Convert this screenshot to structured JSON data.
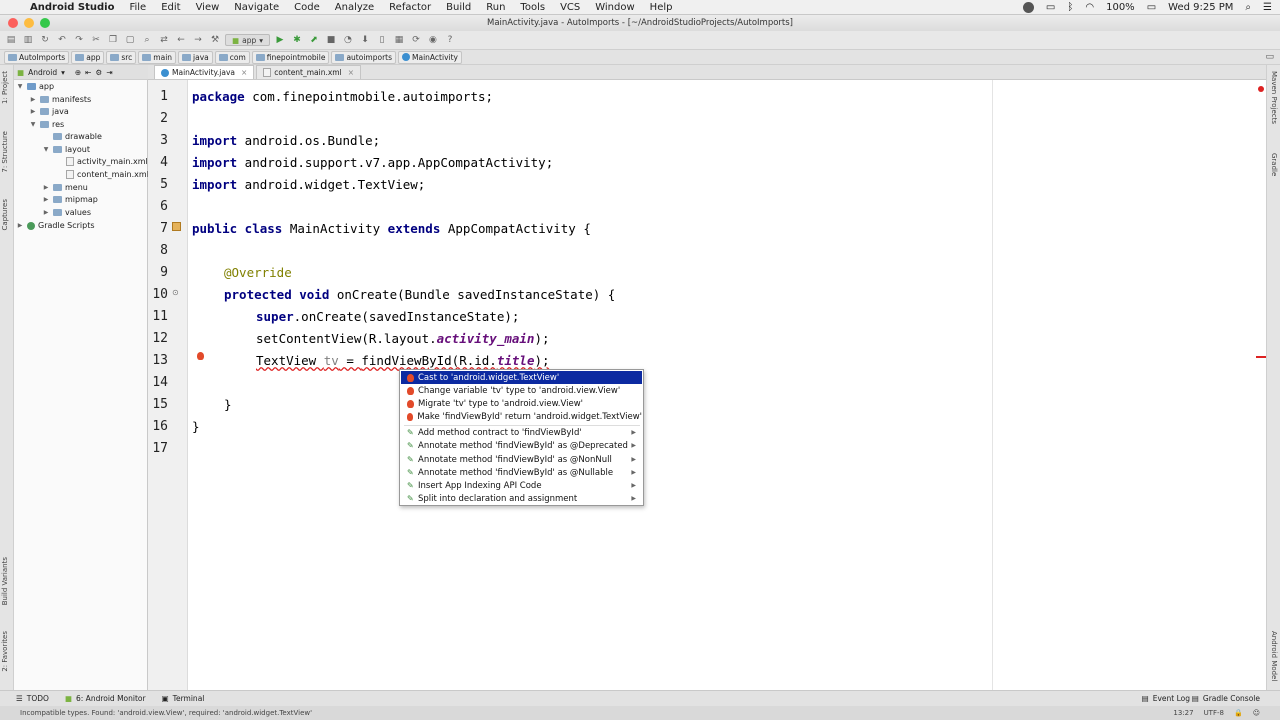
{
  "menubar": {
    "app_name": "Android Studio",
    "items": [
      "File",
      "Edit",
      "View",
      "Navigate",
      "Code",
      "Analyze",
      "Refactor",
      "Build",
      "Run",
      "Tools",
      "VCS",
      "Window",
      "Help"
    ],
    "battery": "100%",
    "clock": "Wed 9:25 PM"
  },
  "window": {
    "title": "MainActivity.java - AutoImports - [~/AndroidStudioProjects/AutoImports]"
  },
  "toolbar": {
    "run_config": "app"
  },
  "breadcrumbs": [
    "AutoImports",
    "app",
    "src",
    "main",
    "java",
    "com",
    "finepointmobile",
    "autoimports",
    "MainActivity"
  ],
  "project": {
    "view_mode": "Android",
    "tree": [
      {
        "label": "app",
        "depth": 0,
        "expanded": true,
        "kind": "module"
      },
      {
        "label": "manifests",
        "depth": 1,
        "expanded": false,
        "kind": "folder"
      },
      {
        "label": "java",
        "depth": 1,
        "expanded": false,
        "kind": "folder"
      },
      {
        "label": "res",
        "depth": 1,
        "expanded": true,
        "kind": "folder"
      },
      {
        "label": "drawable",
        "depth": 2,
        "expanded": false,
        "kind": "folder"
      },
      {
        "label": "layout",
        "depth": 2,
        "expanded": true,
        "kind": "folder"
      },
      {
        "label": "activity_main.xml",
        "depth": 3,
        "kind": "file"
      },
      {
        "label": "content_main.xml",
        "depth": 3,
        "kind": "file"
      },
      {
        "label": "menu",
        "depth": 2,
        "expanded": false,
        "kind": "folder"
      },
      {
        "label": "mipmap",
        "depth": 2,
        "expanded": false,
        "kind": "folder"
      },
      {
        "label": "values",
        "depth": 2,
        "expanded": false,
        "kind": "folder"
      },
      {
        "label": "Gradle Scripts",
        "depth": 0,
        "expanded": false,
        "kind": "gradle"
      }
    ]
  },
  "tool_windows": {
    "left": [
      "1: Project",
      "7: Structure",
      "Captures",
      "Build Variants",
      "2: Favorites"
    ],
    "right": [
      "Maven Projects",
      "Gradle",
      "Android Model"
    ]
  },
  "editor": {
    "tabs": [
      {
        "label": "MainActivity.java",
        "active": true
      },
      {
        "label": "content_main.xml",
        "active": false
      }
    ],
    "line_numbers": [
      "1",
      "2",
      "3",
      "4",
      "5",
      "6",
      "7",
      "8",
      "9",
      "10",
      "11",
      "12",
      "13",
      "14",
      "15",
      "16",
      "17"
    ],
    "code": {
      "l1_kw": "package",
      "l1_rest": " com.finepointmobile.autoimports;",
      "l3_kw": "import",
      "l3_rest": " android.os.Bundle;",
      "l4_kw": "import",
      "l4_rest": " android.support.v7.app.AppCompatActivity;",
      "l5_kw": "import",
      "l5_rest": " android.widget.TextView;",
      "l7_kw1": "public class",
      "l7_mid": " MainActivity ",
      "l7_kw2": "extends",
      "l7_rest": " AppCompatActivity {",
      "l9": "@Override",
      "l10_kw": "protected void",
      "l10_rest": " onCreate(Bundle savedInstanceState) {",
      "l11_kw": "super",
      "l11_rest": ".onCreate(savedInstanceState);",
      "l12_a": "setContentView(R.layout.",
      "l12_fld": "activity_main",
      "l12_b": ");",
      "l13_a": "TextView ",
      "l13_var": "tv",
      "l13_b": " = ",
      "l13_call": "findViewById(R.id.",
      "l13_fld": "title",
      "l13_c": ");",
      "l15": "}",
      "l16": "}"
    }
  },
  "popup": {
    "items": [
      {
        "label": "Cast to 'android.widget.TextView'",
        "icon": "bulb",
        "selected": true,
        "submenu": false
      },
      {
        "label": "Change variable 'tv' type to 'android.view.View'",
        "icon": "bulb",
        "selected": false,
        "submenu": false
      },
      {
        "label": "Migrate 'tv' type to 'android.view.View'",
        "icon": "bulb",
        "selected": false,
        "submenu": false
      },
      {
        "label": "Make 'findViewById' return 'android.widget.TextView'",
        "icon": "bulb",
        "selected": false,
        "submenu": false
      },
      {
        "label": "Add method contract to 'findViewById'",
        "icon": "pencil",
        "selected": false,
        "submenu": true
      },
      {
        "label": "Annotate method 'findViewById' as @Deprecated",
        "icon": "pencil",
        "selected": false,
        "submenu": true
      },
      {
        "label": "Annotate method 'findViewById' as @NonNull",
        "icon": "pencil",
        "selected": false,
        "submenu": true
      },
      {
        "label": "Annotate method 'findViewById' as @Nullable",
        "icon": "pencil",
        "selected": false,
        "submenu": true
      },
      {
        "label": "Insert App Indexing API Code",
        "icon": "pencil",
        "selected": false,
        "submenu": true
      },
      {
        "label": "Split into declaration and assignment",
        "icon": "pencil",
        "selected": false,
        "submenu": true
      }
    ]
  },
  "bottom_tabs": {
    "todo": "TODO",
    "monitor": "6: Android Monitor",
    "terminal": "Terminal",
    "event_log": "Event Log",
    "gradle_console": "Gradle Console"
  },
  "status": {
    "message": "Incompatible types. Found: 'android.view.View', required: 'android.widget.TextView'",
    "position": "13:27",
    "encoding": "UTF-8"
  },
  "colors": {
    "selection": "#0c2aa1",
    "keyword": "#000080",
    "error": "#d22222"
  }
}
